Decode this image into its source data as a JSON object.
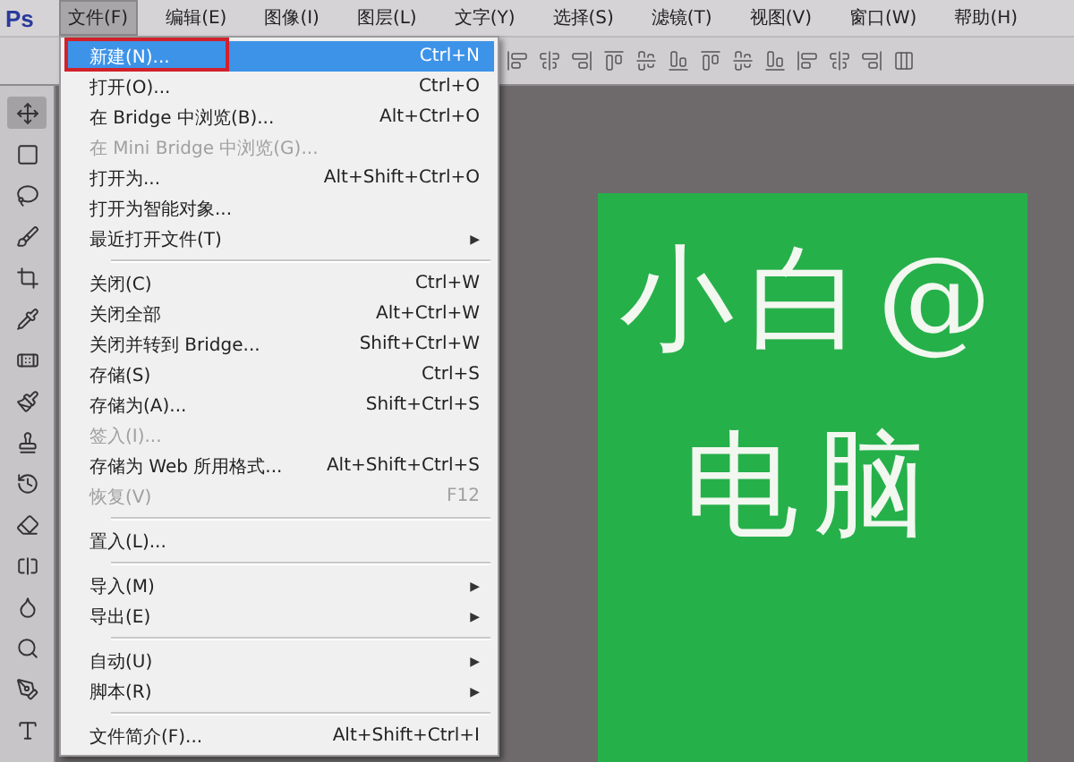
{
  "app": {
    "logo": "Ps"
  },
  "menubar": [
    {
      "label": "文件(F)",
      "selected": true
    },
    {
      "label": "编辑(E)",
      "selected": false
    },
    {
      "label": "图像(I)",
      "selected": false
    },
    {
      "label": "图层(L)",
      "selected": false
    },
    {
      "label": "文字(Y)",
      "selected": false
    },
    {
      "label": "选择(S)",
      "selected": false
    },
    {
      "label": "滤镜(T)",
      "selected": false
    },
    {
      "label": "视图(V)",
      "selected": false
    },
    {
      "label": "窗口(W)",
      "selected": false
    },
    {
      "label": "帮助(H)",
      "selected": false
    }
  ],
  "file_menu": [
    {
      "kind": "item",
      "label": "新建(N)...",
      "shortcut": "Ctrl+N",
      "selected": true,
      "disabled": false,
      "annotated": true
    },
    {
      "kind": "item",
      "label": "打开(O)...",
      "shortcut": "Ctrl+O",
      "selected": false,
      "disabled": false,
      "annotated": false
    },
    {
      "kind": "item",
      "label": "在 Bridge 中浏览(B)...",
      "shortcut": "Alt+Ctrl+O",
      "selected": false,
      "disabled": false,
      "annotated": false
    },
    {
      "kind": "item",
      "label": "在 Mini Bridge 中浏览(G)...",
      "selected": false,
      "disabled": true,
      "annotated": false
    },
    {
      "kind": "item",
      "label": "打开为...",
      "shortcut": "Alt+Shift+Ctrl+O",
      "selected": false,
      "disabled": false,
      "annotated": false
    },
    {
      "kind": "item",
      "label": "打开为智能对象...",
      "selected": false,
      "disabled": false,
      "annotated": false
    },
    {
      "kind": "item",
      "label": "最近打开文件(T)",
      "arrow": "▶",
      "selected": false,
      "disabled": false,
      "annotated": false
    },
    {
      "kind": "separator"
    },
    {
      "kind": "item",
      "label": "关闭(C)",
      "shortcut": "Ctrl+W",
      "selected": false,
      "disabled": false,
      "annotated": false
    },
    {
      "kind": "item",
      "label": "关闭全部",
      "shortcut": "Alt+Ctrl+W",
      "selected": false,
      "disabled": false,
      "annotated": false
    },
    {
      "kind": "item",
      "label": "关闭并转到 Bridge...",
      "shortcut": "Shift+Ctrl+W",
      "selected": false,
      "disabled": false,
      "annotated": false
    },
    {
      "kind": "item",
      "label": "存储(S)",
      "shortcut": "Ctrl+S",
      "selected": false,
      "disabled": false,
      "annotated": false
    },
    {
      "kind": "item",
      "label": "存储为(A)...",
      "shortcut": "Shift+Ctrl+S",
      "selected": false,
      "disabled": false,
      "annotated": false
    },
    {
      "kind": "item",
      "label": "签入(I)...",
      "selected": false,
      "disabled": true,
      "annotated": false
    },
    {
      "kind": "item",
      "label": "存储为 Web 所用格式...",
      "shortcut": "Alt+Shift+Ctrl+S",
      "selected": false,
      "disabled": false,
      "annotated": false
    },
    {
      "kind": "item",
      "label": "恢复(V)",
      "shortcut": "F12",
      "selected": false,
      "disabled": true,
      "annotated": false
    },
    {
      "kind": "separator"
    },
    {
      "kind": "item",
      "label": "置入(L)...",
      "selected": false,
      "disabled": false,
      "annotated": false
    },
    {
      "kind": "separator"
    },
    {
      "kind": "item",
      "label": "导入(M)",
      "arrow": "▶",
      "selected": false,
      "disabled": false,
      "annotated": false
    },
    {
      "kind": "item",
      "label": "导出(E)",
      "arrow": "▶",
      "selected": false,
      "disabled": false,
      "annotated": false
    },
    {
      "kind": "separator"
    },
    {
      "kind": "item",
      "label": "自动(U)",
      "arrow": "▶",
      "selected": false,
      "disabled": false,
      "annotated": false
    },
    {
      "kind": "item",
      "label": "脚本(R)",
      "arrow": "▶",
      "selected": false,
      "disabled": false,
      "annotated": false
    },
    {
      "kind": "separator"
    },
    {
      "kind": "item",
      "label": "文件简介(F)...",
      "shortcut": "Alt+Shift+Ctrl+I",
      "selected": false,
      "disabled": false,
      "annotated": false
    }
  ],
  "canvas": {
    "lines": [
      "小白@",
      "电脑"
    ]
  }
}
